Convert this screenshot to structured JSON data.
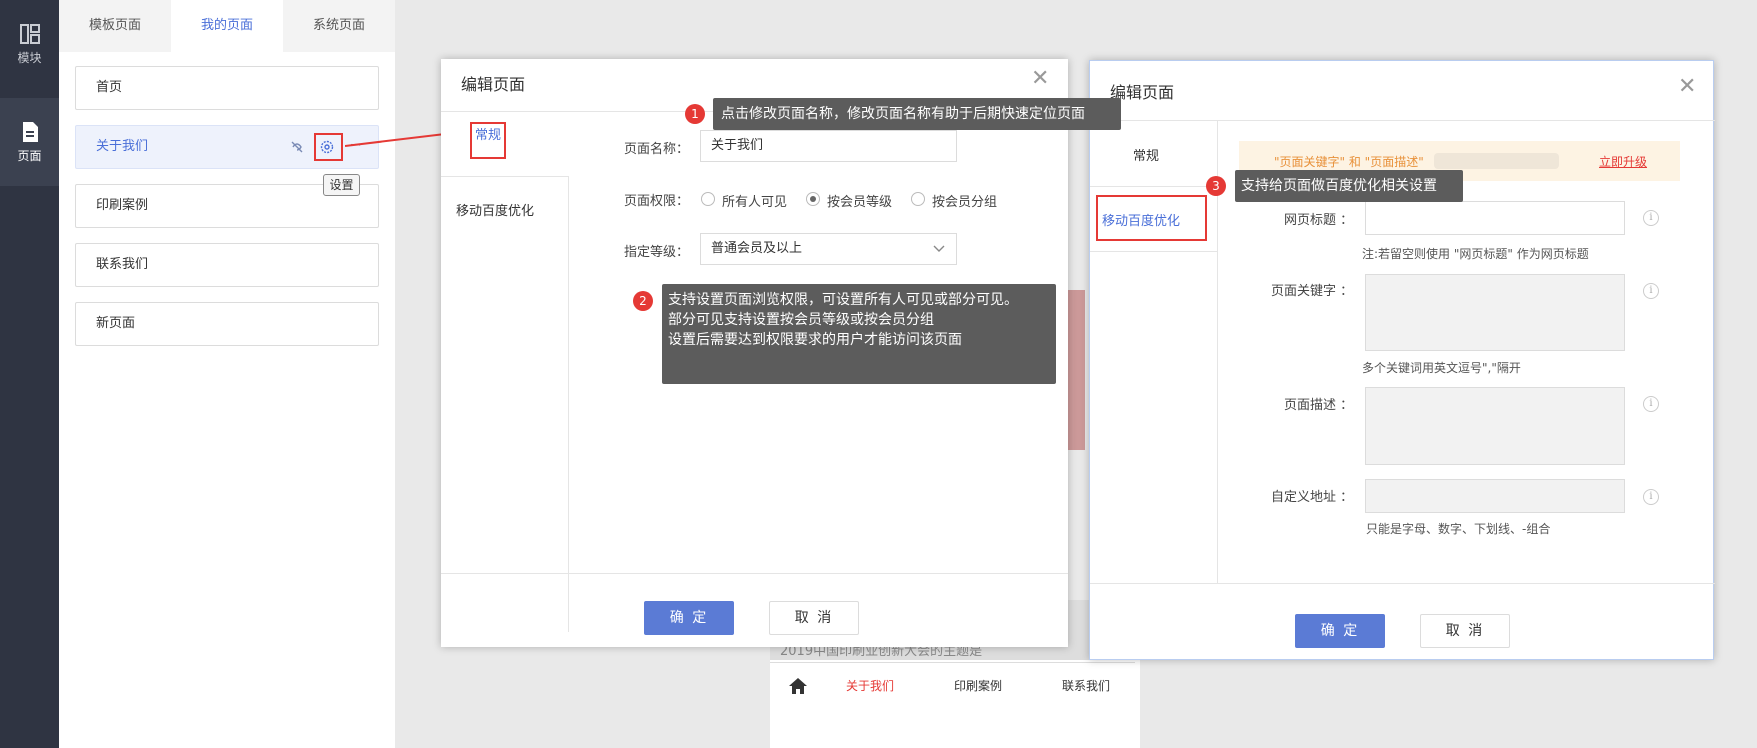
{
  "rail": {
    "items": [
      {
        "label": "模块",
        "icon": "module-icon"
      },
      {
        "label": "页面",
        "icon": "page-icon"
      }
    ]
  },
  "panel": {
    "tabs": [
      "模板页面",
      "我的页面",
      "系统页面"
    ],
    "pages": [
      "首页",
      "关于我们",
      "印刷案例",
      "联系我们",
      "新页面"
    ],
    "settings_tooltip": "设置",
    "more_label": "···"
  },
  "dialog_general": {
    "title": "编辑页面",
    "side_tabs": [
      "常规",
      "移动百度优化"
    ],
    "name_label": "页面名称：",
    "name_value": "关于我们",
    "perm_label": "页面权限：",
    "perm_options": [
      "所有人可见",
      "按会员等级",
      "按会员分组"
    ],
    "perm_selected": 1,
    "level_label": "指定等级：",
    "level_value": "普通会员及以上",
    "ok": "确 定",
    "cancel": "取 消"
  },
  "dialog_seo": {
    "title": "编辑页面",
    "side_tabs": [
      "常规",
      "移动百度优化"
    ],
    "banner_text": "\"页面关键字\" 和 \"页面描述\"",
    "upgrade_link": "立即升级",
    "title_label": "网页标题 ：",
    "title_hint": "注:若留空则使用 \"网页标题\" 作为网页标题",
    "keywords_label": "页面关键字 ：",
    "keywords_hint": "多个关键词用英文逗号\",\"隔开",
    "desc_label": "页面描述 ：",
    "url_label": "自定义地址 ：",
    "url_hint": "只能是字母、数字、下划线、-组合",
    "info_glyph": "i",
    "ok": "确 定",
    "cancel": "取 消"
  },
  "callouts": [
    {
      "num": "1",
      "text": "点击修改页面名称，修改页面名称有助于后期快速定位页面"
    },
    {
      "num": "2",
      "lines": [
        "支持设置页面浏览权限，可设置所有人可见或部分可见。",
        "部分可见支持设置按会员等级或按会员分组",
        "设置后需要达到权限要求的用户才能访问该页面"
      ]
    },
    {
      "num": "3",
      "text": "支持给页面做百度优化相关设置"
    }
  ],
  "preview_nav": {
    "items": [
      "关于我们",
      "印刷案例",
      "联系我们"
    ],
    "caption": "2019中国印刷业创新大会的主题是"
  },
  "colors": {
    "accent": "#4a6fd8",
    "rail_bg": "#2f3442",
    "annotation_red": "#e53935",
    "tip_bg": "#5c5c5c",
    "banner_bg": "#fdf3e3",
    "banner_text": "#e8913a"
  }
}
